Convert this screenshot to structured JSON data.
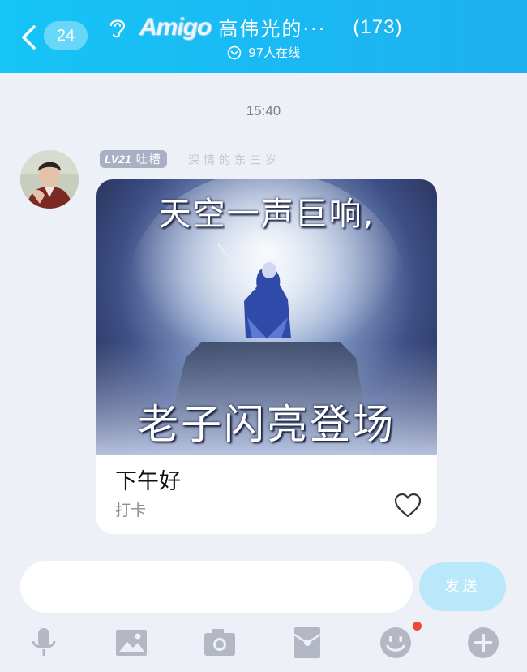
{
  "header": {
    "unread_count": "24",
    "brand": "Amigo",
    "group_name": "高伟光的···",
    "member_count": "(173)",
    "online_text": "97人在线",
    "bg_color": "#16c4f6"
  },
  "chat": {
    "timestamp": "15:40",
    "message": {
      "sender_level": "LV21",
      "sender_title": "吐槽",
      "sender_name": "深情的东三岁",
      "meme_top_text": "天空一声巨响,",
      "meme_bottom_text": "老子闪亮登场",
      "title": "下午好",
      "subtitle": "打卡"
    }
  },
  "composer": {
    "input_value": "",
    "send_label": "发送",
    "send_color": "#b9e8fb"
  },
  "toolbar": {
    "icons": [
      "microphone-icon",
      "image-icon",
      "camera-icon",
      "red-packet-icon",
      "emoji-icon",
      "plus-icon"
    ],
    "emoji_has_notification": true
  }
}
